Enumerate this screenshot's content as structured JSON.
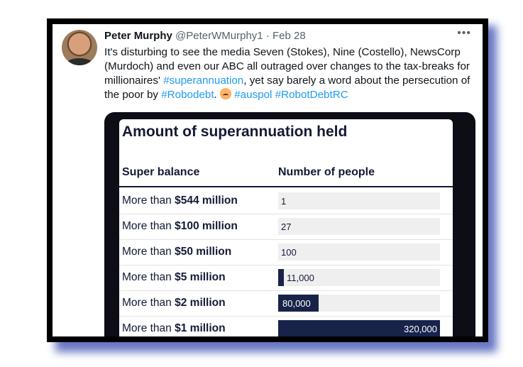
{
  "tweet": {
    "author_name": "Peter Murphy",
    "handle": "@PeterWMurphy1",
    "separator": "·",
    "date": "Feb 28",
    "more_label": "•••",
    "text_parts": [
      "It's disturbing to see the media Seven (Stokes), Nine (Costello), NewsCorp (Murdoch) and even our ABC all outraged over changes to the tax-breaks for millionaires' ",
      "#superannuation",
      ", yet say barely a word about the persecution of the poor by ",
      "#Robodebt",
      ". ",
      " ",
      "#auspol",
      " ",
      "#RobotDebtRC"
    ],
    "emoji_name": "angry-face-emoji"
  },
  "table": {
    "title": "Amount of superannuation held",
    "col1_header": "Super balance",
    "col2_header": "Number of people",
    "rows": [
      {
        "prefix": "More than ",
        "amount": "$544 million",
        "value_label": "1",
        "fraction": 0.0
      },
      {
        "prefix": "More than ",
        "amount": "$100 million",
        "value_label": "27",
        "fraction": 0.0
      },
      {
        "prefix": "More than ",
        "amount": "$50 million",
        "value_label": "100",
        "fraction": 0.0
      },
      {
        "prefix": "More than ",
        "amount": "$5 million",
        "value_label": "11,000",
        "fraction": 0.034
      },
      {
        "prefix": "More than ",
        "amount": "$2 million",
        "value_label": "80,000",
        "fraction": 0.25
      },
      {
        "prefix": "More than ",
        "amount": "$1 million",
        "value_label": "320,000",
        "fraction": 1.0
      }
    ]
  },
  "colors": {
    "link": "#1d9bf0",
    "bar": "#18234a",
    "track": "#efefef",
    "shadow": "#4d5fb8"
  }
}
